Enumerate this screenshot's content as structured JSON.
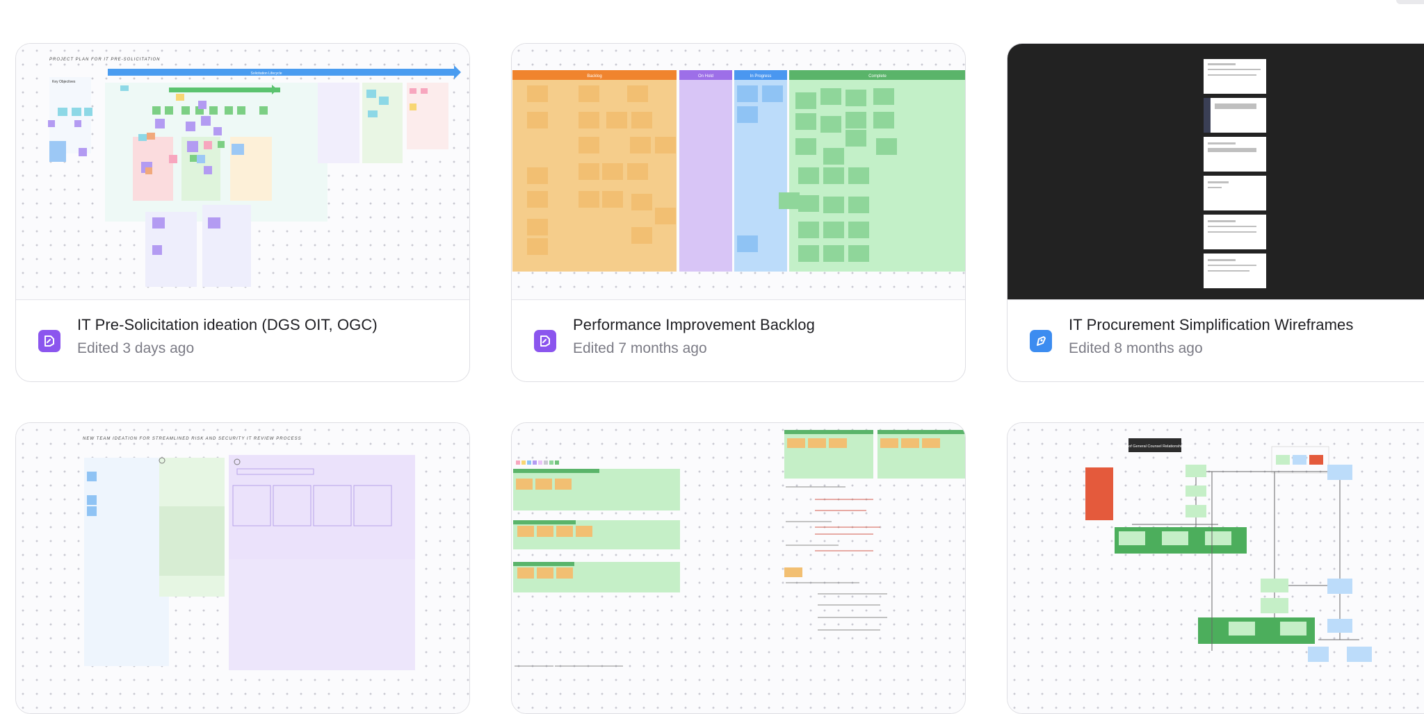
{
  "cards": [
    {
      "title": "IT Pre-Solicitation ideation (DGS OIT, OGC)",
      "edited": "Edited 3 days ago",
      "icon": "whiteboard-icon",
      "icon_color": "#8b55ee",
      "thumbnail": {
        "header": "PROJECT PLAN FOR IT PRE-SOLICITATION",
        "banner": "Solicitation Lifecycle",
        "key_objectives": "Key Objectives"
      }
    },
    {
      "title": "Performance Improvement Backlog",
      "edited": "Edited 7 months ago",
      "icon": "whiteboard-icon",
      "icon_color": "#8b55ee",
      "thumbnail": {
        "columns": [
          "Backlog",
          "On Hold",
          "In Progress",
          "Complete"
        ],
        "column_colors": [
          "#f5cd8b",
          "#d8c5f6",
          "#bcdcfa",
          "#c3f0c8"
        ],
        "header_colors": [
          "#f0842e",
          "#9d6fe8",
          "#4a97f0",
          "#5ab46a"
        ]
      }
    },
    {
      "title": "IT Procurement Simplification Wireframes",
      "edited": "Edited 8 months ago",
      "icon": "design-file-icon",
      "icon_color": "#3c8cf0",
      "thumbnail": {
        "background": "#222222",
        "page_count": 6
      }
    },
    {
      "title": "",
      "edited": "",
      "thumbnail": {
        "header": "NEW TEAM IDEATION FOR STREAMLINED RISK AND SECURITY IT REVIEW PROCESS"
      }
    },
    {
      "title": "",
      "edited": "",
      "thumbnail": {}
    },
    {
      "title": "",
      "edited": "",
      "thumbnail": {
        "header": "Office of General Counsel Relationship Map"
      }
    }
  ]
}
